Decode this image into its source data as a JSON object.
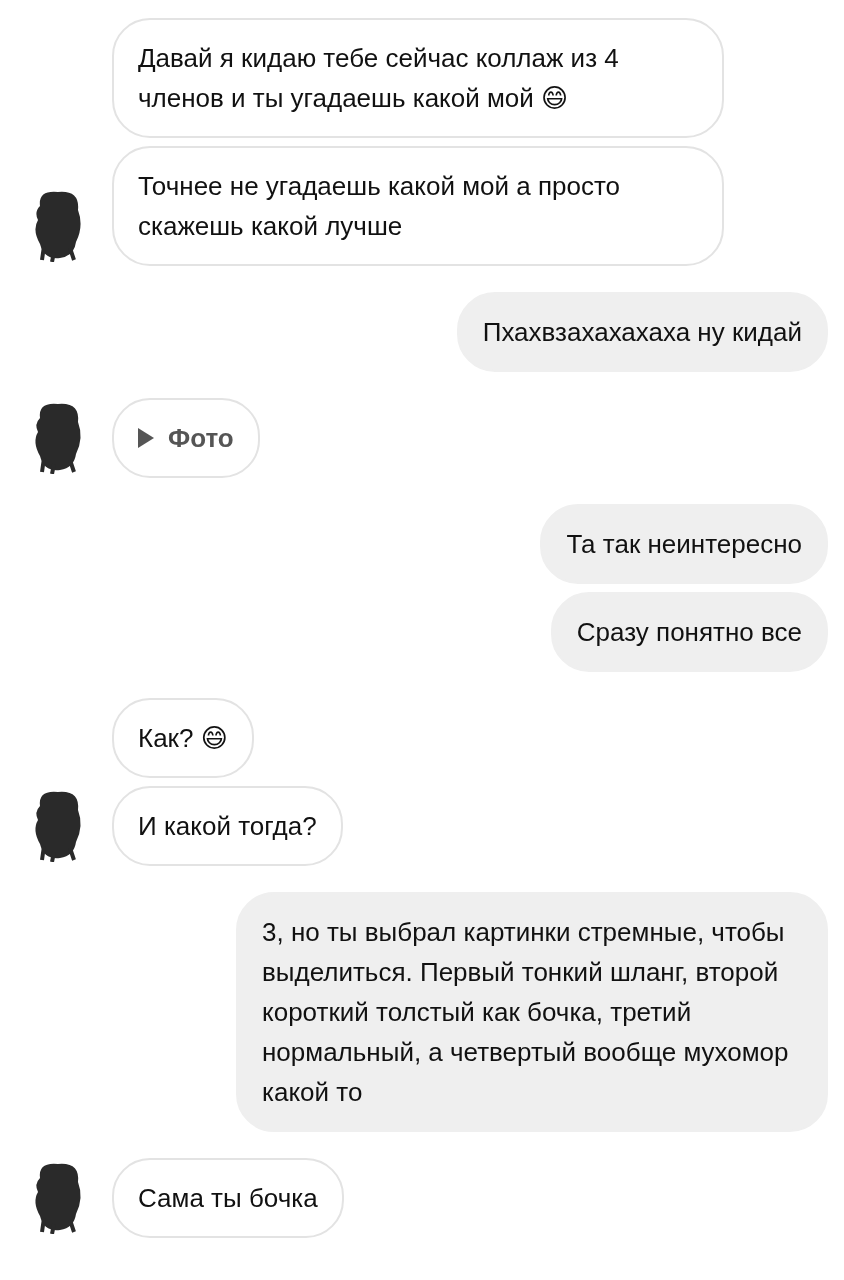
{
  "messages": [
    {
      "outgoing": false,
      "kind": "text",
      "text": "Давай я кидаю тебе сейчас коллаж из 4 членов и ты угадаешь какой мой 😄",
      "avatar": false
    },
    {
      "outgoing": false,
      "kind": "text",
      "text": "Точнее не угадаешь какой мой а просто скажешь какой лучше",
      "avatar": true
    },
    {
      "outgoing": true,
      "kind": "text",
      "text": "Пхахвзахахахаха ну кидай",
      "avatar": false
    },
    {
      "outgoing": false,
      "kind": "photo",
      "text": "Фото",
      "avatar": true
    },
    {
      "outgoing": true,
      "kind": "text",
      "text": "Та так неинтересно",
      "avatar": false
    },
    {
      "outgoing": true,
      "kind": "text",
      "text": "Сразу понятно все",
      "avatar": false
    },
    {
      "outgoing": false,
      "kind": "text",
      "text": "Как? 😄",
      "avatar": false
    },
    {
      "outgoing": false,
      "kind": "text",
      "text": "И какой тогда?",
      "avatar": true
    },
    {
      "outgoing": true,
      "kind": "text",
      "text": "3, но ты выбрал картинки стремные, чтобы выделиться. Первый тонкий шланг, второй короткий толстый как бочка, третий нормальный, а четвертый вообще мухомор какой то",
      "avatar": false
    },
    {
      "outgoing": false,
      "kind": "text",
      "text": "Сама ты бочка",
      "avatar": true
    }
  ]
}
